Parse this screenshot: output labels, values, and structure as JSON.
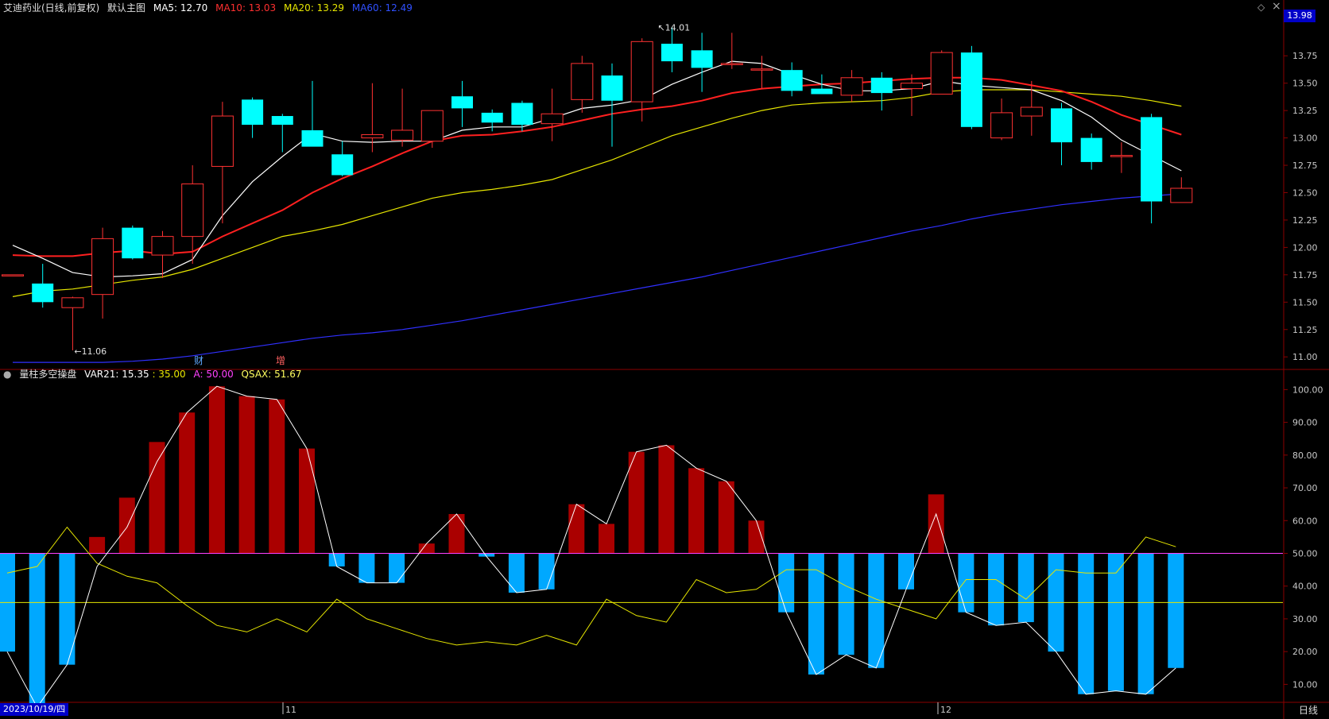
{
  "header": {
    "stock_name": "艾迪药业(日线,前复权)",
    "main_chart_label": "默认主图",
    "ma5": "MA5: 12.70",
    "ma10": "MA10: 13.03",
    "ma20": "MA20: 13.29",
    "ma60": "MA60: 12.49",
    "diamond_icon": "◇",
    "close_icon": "×"
  },
  "price_box": "13.98",
  "sub_header": {
    "indicator_name": "量柱多空操盘",
    "var21": "VAR21: 15.35",
    "var21_level": ": 35.00",
    "a": "A: 50.00",
    "qsax": "QSAX: 51.67"
  },
  "markers": {
    "high_label": "14.01",
    "low_label": "11.06",
    "event1": "财",
    "event2": "增"
  },
  "date_axis": {
    "cursor_date": "2023/10/19/四",
    "month1": "11",
    "month2": "12"
  },
  "timeframe": "日线",
  "colors": {
    "up": "#ff3232",
    "down": "#00ffff",
    "ma5": "#ffffff",
    "ma10": "#ff2020",
    "ma20": "#e6e600",
    "ma60": "#3030ff",
    "bar_up": "#aa0000",
    "bar_down": "#00a8ff",
    "grid": "#8b0000"
  },
  "chart_data": [
    {
      "type": "candlestick",
      "title": "艾迪药业(日线,前复权)",
      "y_ticks": [
        11.0,
        11.25,
        11.5,
        11.75,
        12.0,
        12.25,
        12.5,
        12.75,
        13.0,
        13.25,
        13.5,
        13.75
      ],
      "ylim": [
        10.9,
        14.1
      ],
      "candles": [
        {
          "o": 11.75,
          "h": 11.75,
          "l": 11.75,
          "c": 11.75
        },
        {
          "o": 11.67,
          "h": 11.85,
          "l": 11.45,
          "c": 11.5
        },
        {
          "o": 11.45,
          "h": 11.55,
          "l": 11.06,
          "c": 11.54
        },
        {
          "o": 11.57,
          "h": 12.18,
          "l": 11.35,
          "c": 12.08
        },
        {
          "o": 12.18,
          "h": 12.2,
          "l": 11.89,
          "c": 11.9
        },
        {
          "o": 11.93,
          "h": 12.15,
          "l": 11.72,
          "c": 12.1
        },
        {
          "o": 12.1,
          "h": 12.75,
          "l": 11.85,
          "c": 12.58
        },
        {
          "o": 12.74,
          "h": 13.33,
          "l": 12.22,
          "c": 13.2
        },
        {
          "o": 13.35,
          "h": 13.37,
          "l": 13.0,
          "c": 13.12
        },
        {
          "o": 13.2,
          "h": 13.22,
          "l": 12.87,
          "c": 13.12
        },
        {
          "o": 13.07,
          "h": 13.52,
          "l": 12.93,
          "c": 12.92
        },
        {
          "o": 12.85,
          "h": 12.97,
          "l": 12.65,
          "c": 12.66
        },
        {
          "o": 13.0,
          "h": 13.5,
          "l": 12.87,
          "c": 13.03
        },
        {
          "o": 12.98,
          "h": 13.45,
          "l": 12.92,
          "c": 13.07
        },
        {
          "o": 12.97,
          "h": 13.2,
          "l": 12.91,
          "c": 13.25
        },
        {
          "o": 13.38,
          "h": 13.52,
          "l": 13.1,
          "c": 13.27
        },
        {
          "o": 13.23,
          "h": 13.26,
          "l": 13.06,
          "c": 13.14
        },
        {
          "o": 13.32,
          "h": 13.34,
          "l": 13.06,
          "c": 13.12
        },
        {
          "o": 13.13,
          "h": 13.45,
          "l": 12.97,
          "c": 13.22
        },
        {
          "o": 13.35,
          "h": 13.75,
          "l": 13.23,
          "c": 13.68
        },
        {
          "o": 13.57,
          "h": 13.68,
          "l": 12.92,
          "c": 13.34
        },
        {
          "o": 13.33,
          "h": 13.91,
          "l": 13.15,
          "c": 13.88
        },
        {
          "o": 13.86,
          "h": 14.01,
          "l": 13.6,
          "c": 13.7
        },
        {
          "o": 13.8,
          "h": 13.96,
          "l": 13.42,
          "c": 13.64
        },
        {
          "o": 13.68,
          "h": 13.96,
          "l": 13.63,
          "c": 13.68
        },
        {
          "o": 13.63,
          "h": 13.75,
          "l": 13.45,
          "c": 13.63
        },
        {
          "o": 13.62,
          "h": 13.69,
          "l": 13.38,
          "c": 13.43
        },
        {
          "o": 13.45,
          "h": 13.58,
          "l": 13.4,
          "c": 13.4
        },
        {
          "o": 13.39,
          "h": 13.62,
          "l": 13.33,
          "c": 13.55
        },
        {
          "o": 13.55,
          "h": 13.6,
          "l": 13.25,
          "c": 13.41
        },
        {
          "o": 13.45,
          "h": 13.58,
          "l": 13.2,
          "c": 13.5
        },
        {
          "o": 13.4,
          "h": 13.8,
          "l": 13.4,
          "c": 13.78
        },
        {
          "o": 13.78,
          "h": 13.84,
          "l": 13.08,
          "c": 13.1
        },
        {
          "o": 13.0,
          "h": 13.36,
          "l": 12.98,
          "c": 13.23
        },
        {
          "o": 13.2,
          "h": 13.52,
          "l": 13.02,
          "c": 13.28
        },
        {
          "o": 13.27,
          "h": 13.32,
          "l": 12.75,
          "c": 12.96
        },
        {
          "o": 13.0,
          "h": 13.04,
          "l": 12.71,
          "c": 12.78
        },
        {
          "o": 12.84,
          "h": 12.96,
          "l": 12.68,
          "c": 12.84
        },
        {
          "o": 13.19,
          "h": 13.22,
          "l": 12.22,
          "c": 12.42
        },
        {
          "o": 12.41,
          "h": 12.64,
          "l": 12.41,
          "c": 12.54
        }
      ],
      "series": [
        {
          "name": "MA5",
          "values": [
            12.02,
            11.9,
            11.77,
            11.73,
            11.74,
            11.76,
            11.89,
            12.29,
            12.6,
            12.83,
            13.04,
            12.97,
            12.96,
            12.97,
            12.97,
            13.07,
            13.1,
            13.1,
            13.18,
            13.27,
            13.3,
            13.35,
            13.49,
            13.6,
            13.7,
            13.68,
            13.58,
            13.49,
            13.43,
            13.43,
            13.45,
            13.52,
            13.48,
            13.46,
            13.44,
            13.34,
            13.19,
            12.98,
            12.84,
            12.7
          ]
        },
        {
          "name": "MA10",
          "values": [
            11.93,
            11.92,
            11.92,
            11.95,
            11.97,
            11.94,
            11.96,
            12.1,
            12.22,
            12.34,
            12.5,
            12.63,
            12.74,
            12.86,
            12.97,
            13.02,
            13.03,
            13.06,
            13.1,
            13.16,
            13.22,
            13.26,
            13.29,
            13.34,
            13.41,
            13.45,
            13.47,
            13.49,
            13.5,
            13.52,
            13.54,
            13.55,
            13.55,
            13.53,
            13.48,
            13.43,
            13.33,
            13.21,
            13.12,
            13.03
          ]
        },
        {
          "name": "MA20",
          "values": [
            11.55,
            11.6,
            11.62,
            11.66,
            11.7,
            11.73,
            11.8,
            11.9,
            12.0,
            12.1,
            12.15,
            12.21,
            12.29,
            12.37,
            12.45,
            12.5,
            12.53,
            12.57,
            12.62,
            12.71,
            12.8,
            12.91,
            13.02,
            13.1,
            13.18,
            13.25,
            13.3,
            13.32,
            13.33,
            13.34,
            13.37,
            13.42,
            13.44,
            13.44,
            13.44,
            13.42,
            13.4,
            13.38,
            13.34,
            13.29
          ]
        },
        {
          "name": "MA60",
          "values": [
            10.95,
            10.95,
            10.95,
            10.95,
            10.96,
            10.98,
            11.01,
            11.05,
            11.09,
            11.13,
            11.17,
            11.2,
            11.22,
            11.25,
            11.29,
            11.33,
            11.38,
            11.43,
            11.48,
            11.53,
            11.58,
            11.63,
            11.68,
            11.73,
            11.79,
            11.85,
            11.91,
            11.97,
            12.03,
            12.09,
            12.15,
            12.2,
            12.26,
            12.31,
            12.35,
            12.39,
            12.42,
            12.45,
            12.47,
            12.49
          ]
        }
      ]
    },
    {
      "type": "bar",
      "title": "量柱多空操盘",
      "y_ticks": [
        10.0,
        20.0,
        30.0,
        40.0,
        50.0,
        60.0,
        70.0,
        80.0,
        90.0,
        100.0
      ],
      "ylim": [
        5,
        103
      ],
      "baseline": 50,
      "bars": [
        20,
        3,
        16,
        55,
        67,
        84,
        93,
        101,
        98,
        97,
        82,
        46,
        41,
        41,
        53,
        62,
        49,
        38,
        39,
        65,
        59,
        81,
        83,
        76,
        72,
        60,
        32,
        13,
        19,
        15,
        39,
        68,
        32,
        28,
        29,
        20,
        7,
        8,
        7,
        15
      ],
      "series": [
        {
          "name": "VAR21",
          "values": [
            44,
            46,
            58,
            47,
            43,
            41,
            34,
            28,
            26,
            30,
            26,
            36,
            30,
            27,
            24,
            22,
            23,
            22,
            25,
            22,
            36,
            31,
            29,
            42,
            38,
            39,
            45,
            45,
            40,
            36,
            33,
            30,
            42,
            42,
            36,
            45,
            44,
            44,
            55,
            52
          ]
        },
        {
          "name": "VAR21_level",
          "values": [
            35
          ]
        },
        {
          "name": "A",
          "values": [
            50
          ]
        },
        {
          "name": "QSAX",
          "values": [
            20,
            3,
            16,
            46,
            58,
            78,
            93,
            101,
            98,
            97,
            82,
            46,
            41,
            41,
            53,
            62,
            49,
            38,
            39,
            65,
            59,
            81,
            83,
            76,
            72,
            60,
            32,
            13,
            19,
            15,
            39,
            62,
            32,
            28,
            29,
            20,
            7,
            8,
            7,
            15
          ]
        }
      ]
    }
  ]
}
